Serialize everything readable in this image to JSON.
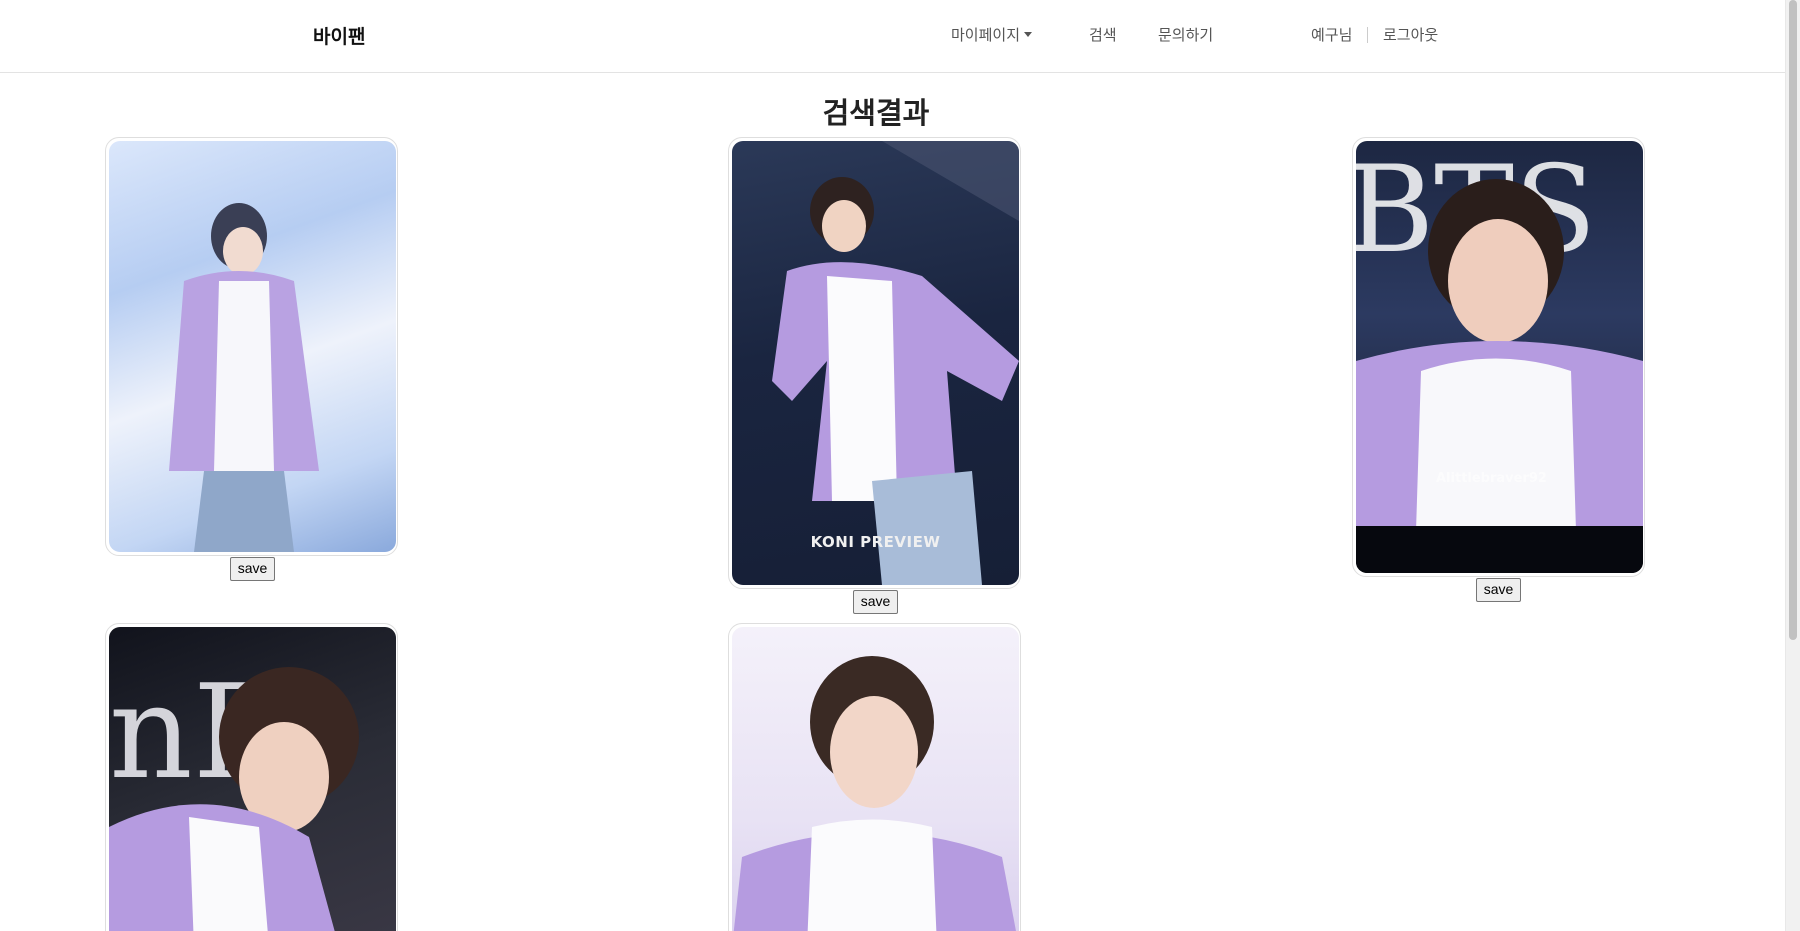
{
  "navbar": {
    "brand": "바이팬",
    "mypage_label": "마이페이지",
    "search_label": "검색",
    "inquiry_label": "문의하기",
    "user_label": "예구님",
    "logout_label": "로그아웃"
  },
  "page": {
    "title": "검색결과"
  },
  "results": {
    "save_label": "save",
    "card2_caption": "KONI PREVIEW",
    "card3_watermark": "Alittlebraver92"
  },
  "colors": {
    "hoodie": "#b59be0",
    "text_dark": "#222222",
    "nav_text": "#555555"
  }
}
